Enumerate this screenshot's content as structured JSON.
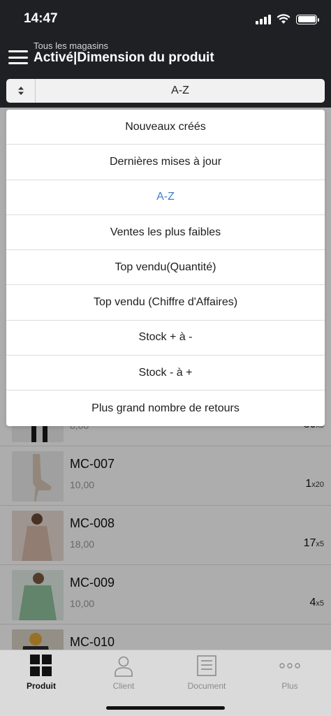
{
  "status_bar": {
    "time": "14:47"
  },
  "header": {
    "subtitle": "Tous les magasins",
    "title": "Activé|Dimension du produit"
  },
  "sort": {
    "selected": "A-Z",
    "options": [
      "Nouveaux créés",
      "Dernières mises à jour",
      "A-Z",
      "Ventes les plus faibles",
      "Top vendu(Quantité)",
      "Top vendu (Chiffre d'Affaires)",
      "Stock + à -",
      "Stock - à +",
      "Plus grand nombre de retours"
    ]
  },
  "products": [
    {
      "name": "",
      "price": "8,00",
      "qty": "30",
      "unit": "x5"
    },
    {
      "name": "MC-007",
      "price": "10,00",
      "qty": "1",
      "unit": "x20"
    },
    {
      "name": "MC-008",
      "price": "18,00",
      "qty": "17",
      "unit": "x5"
    },
    {
      "name": "MC-009",
      "price": "10,00",
      "qty": "4",
      "unit": "x5"
    },
    {
      "name": "MC-010",
      "price": "",
      "qty": "",
      "unit": ""
    }
  ],
  "tabbar": {
    "tabs": [
      {
        "label": "Produit",
        "icon": "grid-icon",
        "active": true
      },
      {
        "label": "Client",
        "icon": "person-icon",
        "active": false
      },
      {
        "label": "Document",
        "icon": "document-icon",
        "active": false
      },
      {
        "label": "Plus",
        "icon": "more-icon",
        "active": false
      }
    ]
  },
  "colors": {
    "accent": "#3f7fc6",
    "header_bg": "#1f2024"
  }
}
